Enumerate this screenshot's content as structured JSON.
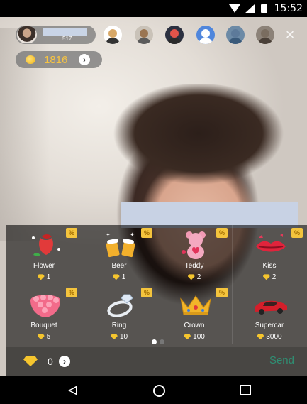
{
  "status_bar": {
    "time": "15:52"
  },
  "host": {
    "viewer_count": "517"
  },
  "coins": {
    "value": "1816"
  },
  "viewers": [
    {
      "head": "#d8a867",
      "body": "#333333",
      "bg": "#ffffff"
    },
    {
      "head": "#9a7552",
      "body": "#5b5b5b",
      "bg": "#c9c2b8"
    },
    {
      "head": "#e2544a",
      "body": "#2a2a2a",
      "bg": "#2b3040"
    },
    {
      "head": "#ffffff",
      "body": "#ffffff",
      "bg": "#4f86dc"
    },
    {
      "head": "#5d7a9a",
      "body": "#3a5a7a",
      "bg": "#6c8aa6"
    },
    {
      "head": "#7a6d60",
      "body": "#4a4038",
      "bg": "#8c8278"
    }
  ],
  "gifts": [
    {
      "name": "Flower",
      "price": "1"
    },
    {
      "name": "Beer",
      "price": "1"
    },
    {
      "name": "Teddy",
      "price": "2"
    },
    {
      "name": "Kiss",
      "price": "2"
    },
    {
      "name": "Bouquet",
      "price": "5"
    },
    {
      "name": "Ring",
      "price": "10"
    },
    {
      "name": "Crown",
      "price": "100"
    },
    {
      "name": "Supercar",
      "price": "3000"
    }
  ],
  "badge_label": "🔇",
  "pagination": {
    "pages": 2,
    "current": 1
  },
  "balance": {
    "value": "0"
  },
  "send_label": "Send",
  "colors": {
    "accent_gold": "#f5c52e",
    "send_green": "#2f8f73"
  }
}
